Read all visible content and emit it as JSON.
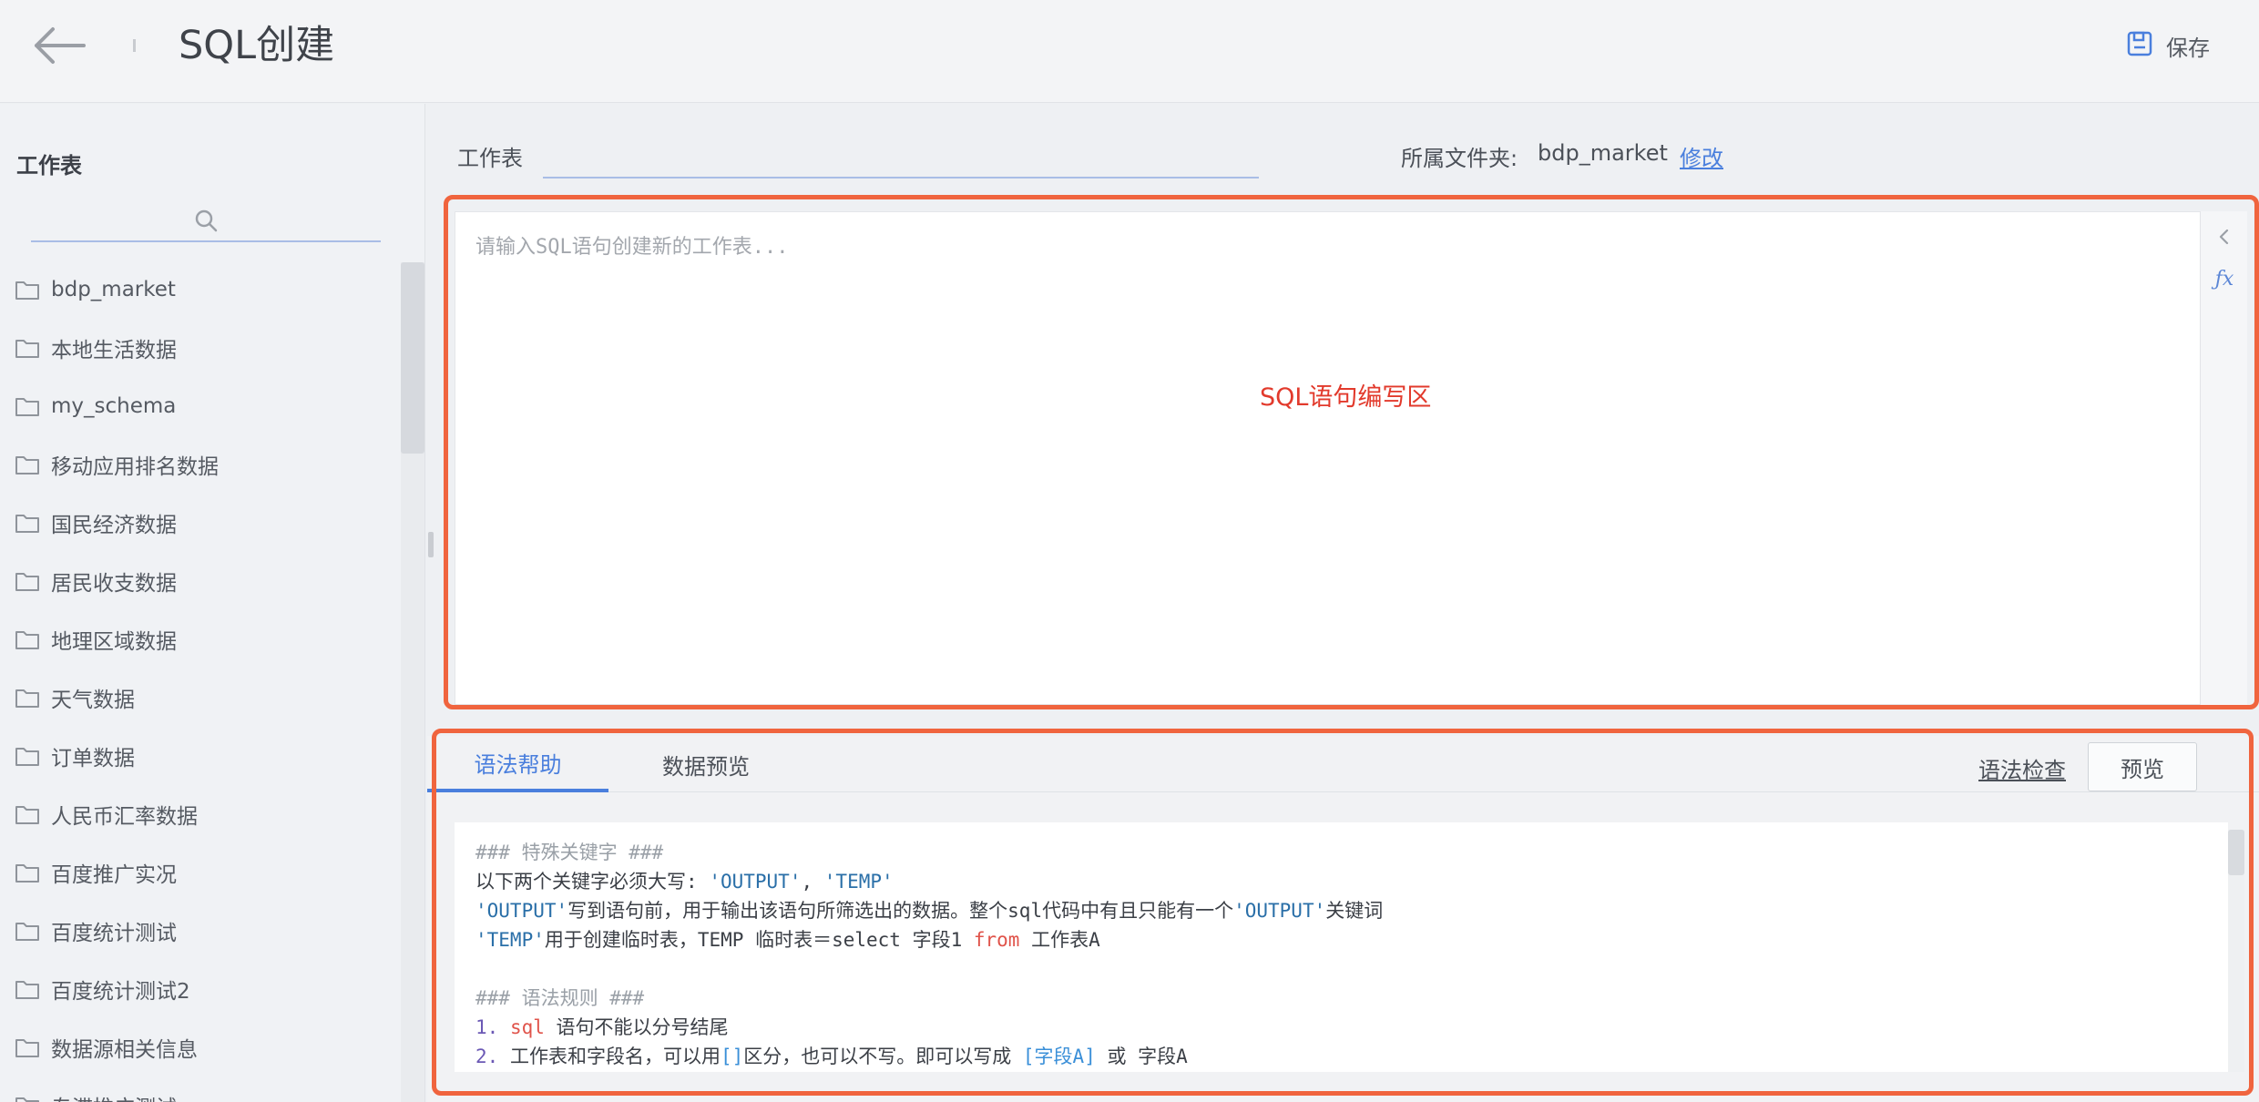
{
  "header": {
    "title": "SQL创建",
    "save_label": "保存"
  },
  "sidebar": {
    "title": "工作表",
    "search_placeholder": "",
    "items": [
      {
        "label": "bdp_market"
      },
      {
        "label": "本地生活数据"
      },
      {
        "label": "my_schema"
      },
      {
        "label": "移动应用排名数据"
      },
      {
        "label": "国民经济数据"
      },
      {
        "label": "居民收支数据"
      },
      {
        "label": "地理区域数据"
      },
      {
        "label": "天气数据"
      },
      {
        "label": "订单数据"
      },
      {
        "label": "人民币汇率数据"
      },
      {
        "label": "百度推广实况"
      },
      {
        "label": "百度统计测试"
      },
      {
        "label": "百度统计测试2"
      },
      {
        "label": "数据源相关信息"
      },
      {
        "label": "专滞推广测试"
      }
    ]
  },
  "main": {
    "sheet_label": "工作表",
    "sheet_value": "",
    "folder_label": "所属文件夹:",
    "folder_value": "bdp_market",
    "folder_edit": "修改",
    "editor_placeholder": "请输入SQL语句创建新的工作表...",
    "editor_annotation": "SQL语句编写区"
  },
  "bottom": {
    "tabs": [
      {
        "label": "语法帮助",
        "active": true
      },
      {
        "label": "数据预览",
        "active": false
      }
    ],
    "syntax_check_label": "语法检查",
    "preview_label": "预览",
    "help": {
      "h1": "### 特殊关键字 ###",
      "l1_a": "以下两个关键字必须大写:",
      "l1_b": "'OUTPUT'",
      "l1_c": ",",
      "l1_d": "'TEMP'",
      "l2_a": "'OUTPUT'",
      "l2_b": "写到语句前，用于输出该语句所筛选出的数据。整个sql代码中有且只能有一个",
      "l2_c": "'OUTPUT'",
      "l2_d": "关键词",
      "l3_a": "'TEMP'",
      "l3_b": "用于创建临时表，TEMP 临时表＝select 字段1",
      "l3_c": "from",
      "l3_d": "工作表A",
      "h2": "### 语法规则 ###",
      "l4_num": "1.",
      "l4_kw": "sql",
      "l4_text": "语句不能以分号结尾",
      "l5_num": "2.",
      "l5_a": "工作表和字段名，可以用",
      "l5_b": "[]",
      "l5_c": "区分，也可以不写。即可以写成",
      "l5_d": "[字段A]",
      "l5_e": "或 字段A"
    }
  },
  "colors": {
    "accent": "#4a7fdd",
    "highlight": "#f0643e",
    "annotation": "#e23a2c"
  }
}
